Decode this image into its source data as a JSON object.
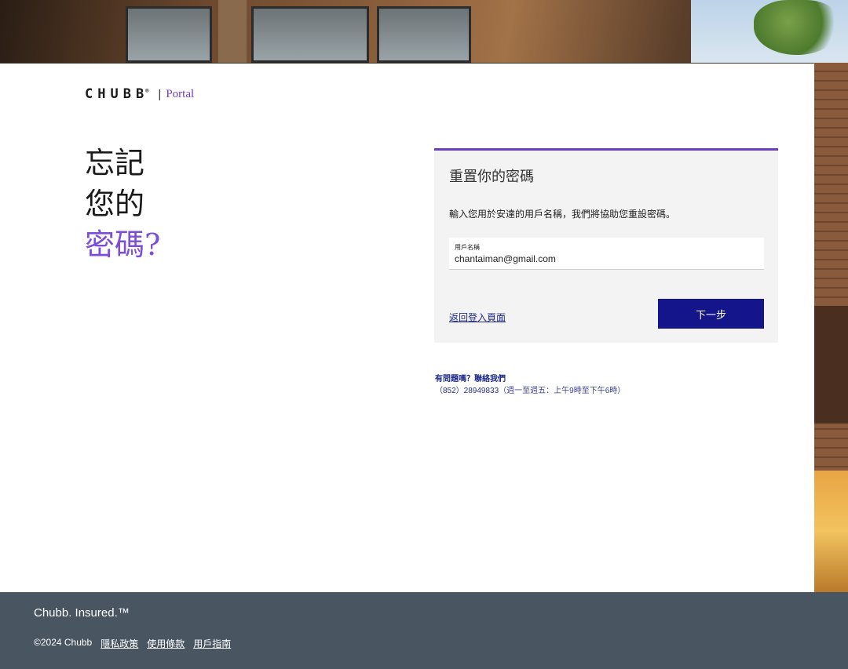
{
  "brand": {
    "logo": "CHUBB",
    "registered": "®",
    "separator": "|",
    "product": "Portal"
  },
  "headline": {
    "line1": "忘記",
    "line2": "您的",
    "line3": "密碼?"
  },
  "reset_panel": {
    "title": "重置你的密碼",
    "description": "輸入您用於安達的用戶名稱，我們將協助您重設密碼。",
    "username_field": {
      "label": "用戶名稱",
      "value": "chantaiman@gmail.com"
    },
    "back_link": "返回登入頁面",
    "next_button": "下一步"
  },
  "help": {
    "title": "有問題嗎？聯絡我們",
    "phone": "（852）28949833",
    "hours": "（週一至週五：上午9時至下午6時）"
  },
  "footer": {
    "tagline": "Chubb. Insured.™",
    "copyright": "©2024 Chubb",
    "links": [
      "隱私政策",
      "使用條款",
      "用戶指南"
    ]
  },
  "colors": {
    "accent_purple": "#7c4dd6",
    "panel_border": "#6b3fb8",
    "button_navy": "#14158a",
    "link_navy": "#1d2a8a",
    "footer_bg": "#4a5562"
  }
}
